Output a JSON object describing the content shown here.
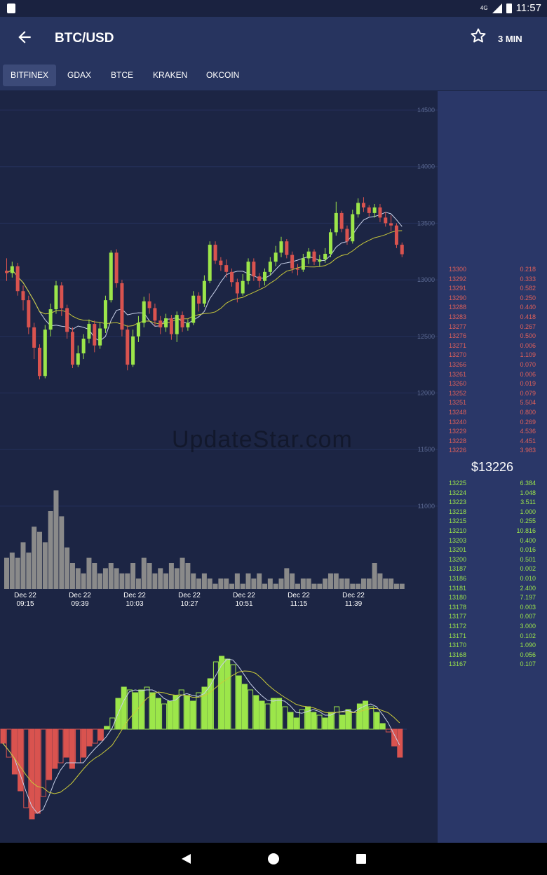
{
  "status_bar": {
    "network": "4G",
    "time": "11:57"
  },
  "app_bar": {
    "title": "BTC/USD",
    "interval": "3 MIN",
    "back_icon": "arrow-back-icon",
    "favorite_icon": "star-outline-icon"
  },
  "exchange_tabs": [
    "BITFINEX",
    "GDAX",
    "BTCE",
    "KRAKEN",
    "OKCOIN"
  ],
  "selected_tab": "BITFINEX",
  "watermark": "UpdateStar.com",
  "chart_data": {
    "type": "candlestick",
    "y_axis_ticks": [
      "14500",
      "14000",
      "13500",
      "13000",
      "12500",
      "12000",
      "11500",
      "11000"
    ],
    "x_axis_ticks": [
      {
        "date": "Dec 22",
        "time": "09:15"
      },
      {
        "date": "Dec 22",
        "time": "09:39"
      },
      {
        "date": "Dec 22",
        "time": "10:03"
      },
      {
        "date": "Dec 22",
        "time": "10:27"
      },
      {
        "date": "Dec 22",
        "time": "10:51"
      },
      {
        "date": "Dec 22",
        "time": "11:15"
      },
      {
        "date": "Dec 22",
        "time": "11:39"
      }
    ],
    "colors": {
      "up": "#9ce64a",
      "down": "#d9534f",
      "volume": "#8a8a8a",
      "ma_fast": "#c8d0e8",
      "ma_slow": "#c9c93a"
    },
    "candles": [
      [
        13080,
        13060,
        13190,
        12990
      ],
      [
        13060,
        13120,
        13160,
        13020
      ],
      [
        13120,
        12900,
        13150,
        12860
      ],
      [
        12900,
        12820,
        12950,
        12730
      ],
      [
        12820,
        12580,
        12860,
        12520
      ],
      [
        12580,
        12400,
        12620,
        12300
      ],
      [
        12400,
        12150,
        12430,
        12120
      ],
      [
        12150,
        12560,
        12600,
        12130
      ],
      [
        12560,
        12740,
        12790,
        12500
      ],
      [
        12740,
        12950,
        12990,
        12700
      ],
      [
        12950,
        12750,
        12980,
        12680
      ],
      [
        12750,
        12540,
        12780,
        12480
      ],
      [
        12540,
        12250,
        12580,
        12220
      ],
      [
        12250,
        12350,
        12420,
        12230
      ],
      [
        12350,
        12480,
        12520,
        12300
      ],
      [
        12480,
        12610,
        12650,
        12440
      ],
      [
        12610,
        12420,
        12640,
        12360
      ],
      [
        12420,
        12570,
        12620,
        12390
      ],
      [
        12570,
        12820,
        12860,
        12530
      ],
      [
        12820,
        13240,
        13260,
        12800
      ],
      [
        13240,
        12970,
        13270,
        12930
      ],
      [
        12970,
        12560,
        13000,
        12500
      ],
      [
        12560,
        12250,
        12600,
        12200
      ],
      [
        12250,
        12500,
        12560,
        12230
      ],
      [
        12500,
        12620,
        12680,
        12450
      ],
      [
        12620,
        12810,
        12850,
        12580
      ],
      [
        12810,
        12750,
        12880,
        12700
      ],
      [
        12750,
        12640,
        12790,
        12590
      ],
      [
        12640,
        12580,
        12680,
        12520
      ],
      [
        12580,
        12660,
        12700,
        12540
      ],
      [
        12660,
        12520,
        12690,
        12470
      ],
      [
        12520,
        12690,
        12720,
        12450
      ],
      [
        12690,
        12580,
        12720,
        12540
      ],
      [
        12580,
        12620,
        12650,
        12550
      ],
      [
        12620,
        12860,
        12900,
        12600
      ],
      [
        12860,
        12790,
        12890,
        12720
      ],
      [
        12790,
        12990,
        13040,
        12760
      ],
      [
        12990,
        13310,
        13340,
        12970
      ],
      [
        13310,
        13170,
        13340,
        13140
      ],
      [
        13170,
        13130,
        13200,
        13080
      ],
      [
        13130,
        13070,
        13180,
        13020
      ],
      [
        13070,
        12980,
        13100,
        12940
      ],
      [
        12980,
        12880,
        13010,
        12800
      ],
      [
        12880,
        12990,
        13050,
        12860
      ],
      [
        12990,
        13160,
        13190,
        12960
      ],
      [
        13160,
        13030,
        13190,
        12990
      ],
      [
        13030,
        12990,
        13060,
        12930
      ],
      [
        12990,
        13070,
        13100,
        12950
      ],
      [
        13070,
        13160,
        13200,
        13040
      ],
      [
        13160,
        13240,
        13300,
        13120
      ],
      [
        13240,
        13340,
        13380,
        13200
      ],
      [
        13340,
        13220,
        13360,
        13190
      ],
      [
        13220,
        13100,
        13250,
        13060
      ],
      [
        13100,
        13090,
        13140,
        13040
      ],
      [
        13090,
        13190,
        13230,
        13070
      ],
      [
        13190,
        13250,
        13280,
        13140
      ],
      [
        13250,
        13160,
        13270,
        13130
      ],
      [
        13160,
        13180,
        13220,
        13120
      ],
      [
        13180,
        13230,
        13280,
        13150
      ],
      [
        13230,
        13420,
        13450,
        13200
      ],
      [
        13420,
        13590,
        13690,
        13390
      ],
      [
        13590,
        13450,
        13610,
        13420
      ],
      [
        13450,
        13340,
        13480,
        13310
      ],
      [
        13340,
        13580,
        13620,
        13320
      ],
      [
        13580,
        13680,
        13720,
        13550
      ],
      [
        13680,
        13640,
        13730,
        13600
      ],
      [
        13640,
        13590,
        13660,
        13560
      ],
      [
        13590,
        13640,
        13670,
        13550
      ],
      [
        13640,
        13550,
        13670,
        13510
      ],
      [
        13550,
        13500,
        13600,
        13470
      ],
      [
        13500,
        13480,
        13570,
        13430
      ],
      [
        13480,
        13310,
        13500,
        13280
      ],
      [
        13310,
        13226,
        13330,
        13200
      ]
    ],
    "volumes": [
      6,
      7,
      6,
      9,
      7,
      12,
      11,
      9,
      15,
      19,
      14,
      8,
      5,
      4,
      3,
      6,
      5,
      3,
      4,
      5,
      4,
      3,
      3,
      5,
      2,
      6,
      5,
      3,
      4,
      3,
      5,
      4,
      6,
      5,
      3,
      2,
      3,
      2,
      1,
      2,
      2,
      1,
      3,
      1,
      3,
      2,
      3,
      1,
      2,
      1,
      2,
      4,
      3,
      1,
      2,
      2,
      1,
      1,
      2,
      3,
      3,
      2,
      2,
      1,
      1,
      2,
      2,
      5,
      3,
      2,
      2,
      1,
      1
    ],
    "macd": [
      -5,
      -10,
      -16,
      -22,
      -28,
      -32,
      -30,
      -24,
      -18,
      -14,
      -12,
      -10,
      -14,
      -12,
      -10,
      -6,
      -5,
      -4,
      1,
      4,
      11,
      15,
      14,
      13,
      14,
      15,
      13,
      11,
      9,
      10,
      12,
      14,
      12,
      10,
      13,
      15,
      18,
      24,
      26,
      25,
      23,
      19,
      16,
      14,
      12,
      10,
      9,
      11,
      11,
      8,
      6,
      4,
      7,
      8,
      6,
      5,
      4,
      6,
      8,
      5,
      7,
      6,
      9,
      10,
      8,
      6,
      2,
      -1,
      -6,
      -10
    ]
  },
  "order_book": {
    "asks": [
      {
        "price": "13300",
        "amount": "0.218"
      },
      {
        "price": "13292",
        "amount": "0.333"
      },
      {
        "price": "13291",
        "amount": "0.582"
      },
      {
        "price": "13290",
        "amount": "0.250"
      },
      {
        "price": "13288",
        "amount": "0.440"
      },
      {
        "price": "13283",
        "amount": "0.418"
      },
      {
        "price": "13277",
        "amount": "0.267"
      },
      {
        "price": "13276",
        "amount": "0.500"
      },
      {
        "price": "13271",
        "amount": "0.006"
      },
      {
        "price": "13270",
        "amount": "1.109"
      },
      {
        "price": "13266",
        "amount": "0.070"
      },
      {
        "price": "13261",
        "amount": "0.006"
      },
      {
        "price": "13260",
        "amount": "0.019"
      },
      {
        "price": "13252",
        "amount": "0.079"
      },
      {
        "price": "13251",
        "amount": "5.504"
      },
      {
        "price": "13248",
        "amount": "0.800"
      },
      {
        "price": "13240",
        "amount": "0.269"
      },
      {
        "price": "13229",
        "amount": "4.536"
      },
      {
        "price": "13228",
        "amount": "4.451"
      },
      {
        "price": "13226",
        "amount": "3.983"
      }
    ],
    "last_price": "$13226",
    "bids": [
      {
        "price": "13225",
        "amount": "6.384"
      },
      {
        "price": "13224",
        "amount": "1.048"
      },
      {
        "price": "13223",
        "amount": "3.511"
      },
      {
        "price": "13218",
        "amount": "1.000"
      },
      {
        "price": "13215",
        "amount": "0.255"
      },
      {
        "price": "13210",
        "amount": "10.816"
      },
      {
        "price": "13203",
        "amount": "0.400"
      },
      {
        "price": "13201",
        "amount": "0.016"
      },
      {
        "price": "13200",
        "amount": "0.501"
      },
      {
        "price": "13187",
        "amount": "0.002"
      },
      {
        "price": "13186",
        "amount": "0.010"
      },
      {
        "price": "13181",
        "amount": "2.400"
      },
      {
        "price": "13180",
        "amount": "7.197"
      },
      {
        "price": "13178",
        "amount": "0.003"
      },
      {
        "price": "13177",
        "amount": "0.007"
      },
      {
        "price": "13172",
        "amount": "3.000"
      },
      {
        "price": "13171",
        "amount": "0.102"
      },
      {
        "price": "13170",
        "amount": "1.090"
      },
      {
        "price": "13168",
        "amount": "0.056"
      },
      {
        "price": "13167",
        "amount": "0.107"
      }
    ]
  },
  "nav_bar": {
    "back_icon": "nav-back-icon",
    "home_icon": "nav-home-icon",
    "recents_icon": "nav-recents-icon"
  }
}
